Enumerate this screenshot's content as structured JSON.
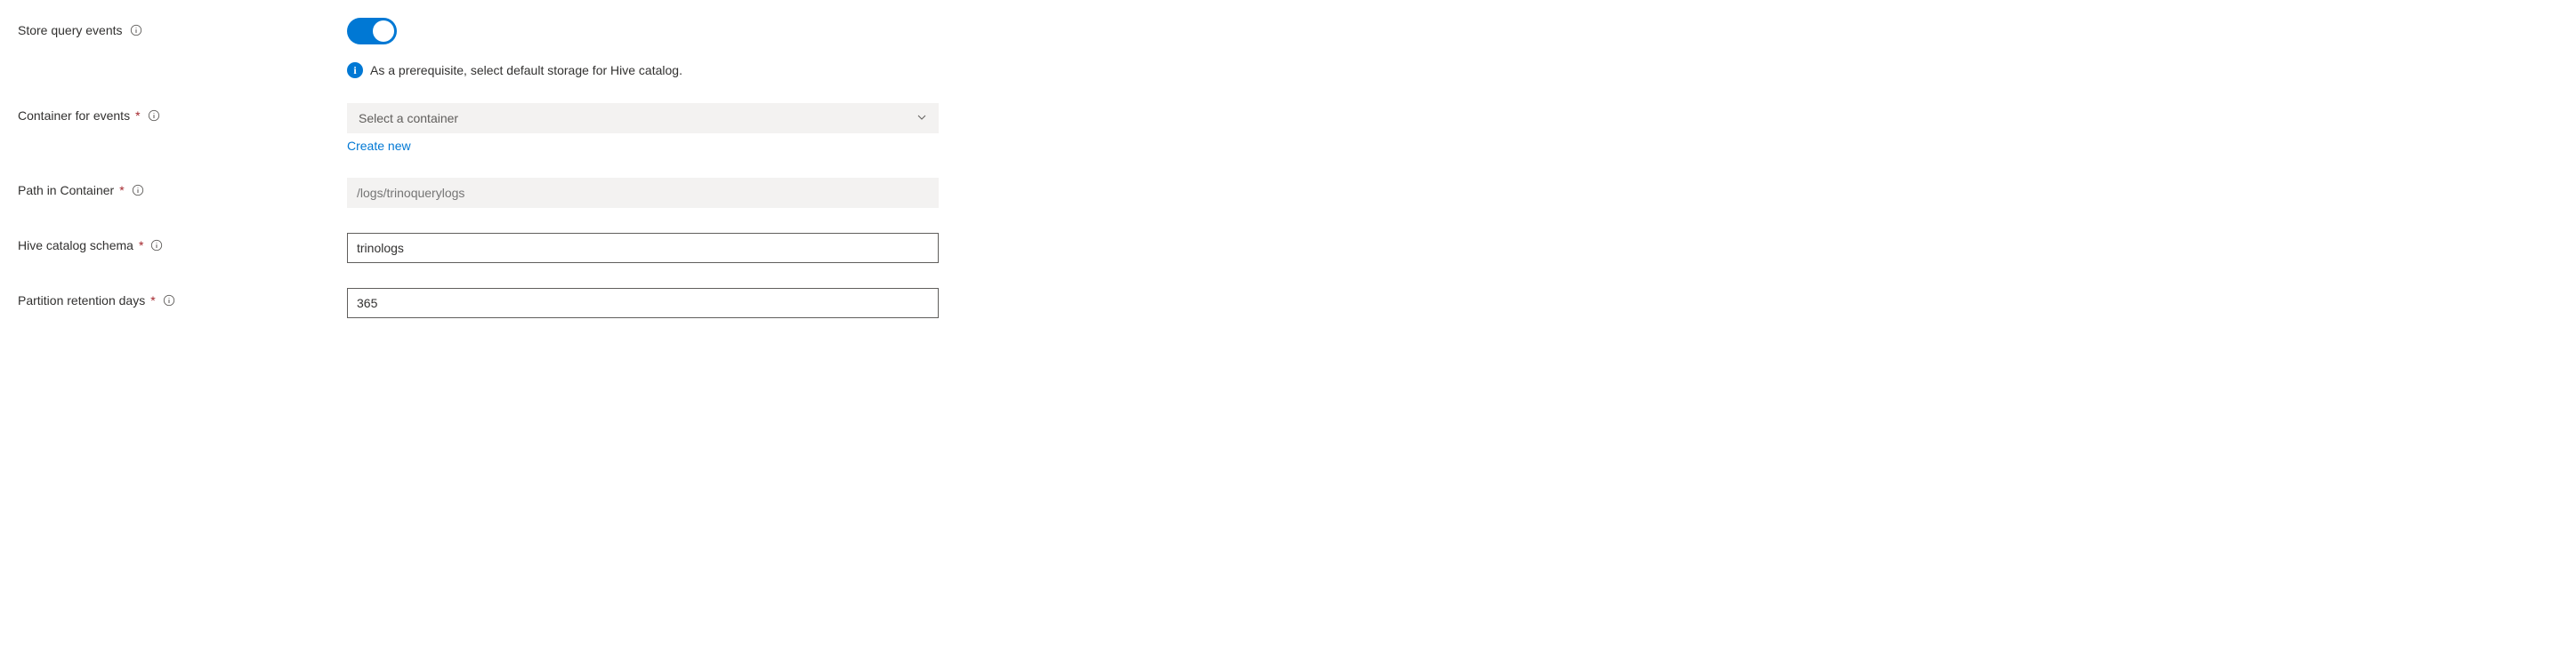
{
  "fields": {
    "store_query_events": {
      "label": "Store query events",
      "enabled": true,
      "info_message": "As a prerequisite, select default storage for Hive catalog."
    },
    "container_for_events": {
      "label": "Container for events",
      "placeholder": "Select a container",
      "create_new_link": "Create new"
    },
    "path_in_container": {
      "label": "Path in Container",
      "placeholder": "/logs/trinoquerylogs"
    },
    "hive_catalog_schema": {
      "label": "Hive catalog schema",
      "value": "trinologs"
    },
    "partition_retention_days": {
      "label": "Partition retention days",
      "value": "365"
    }
  }
}
